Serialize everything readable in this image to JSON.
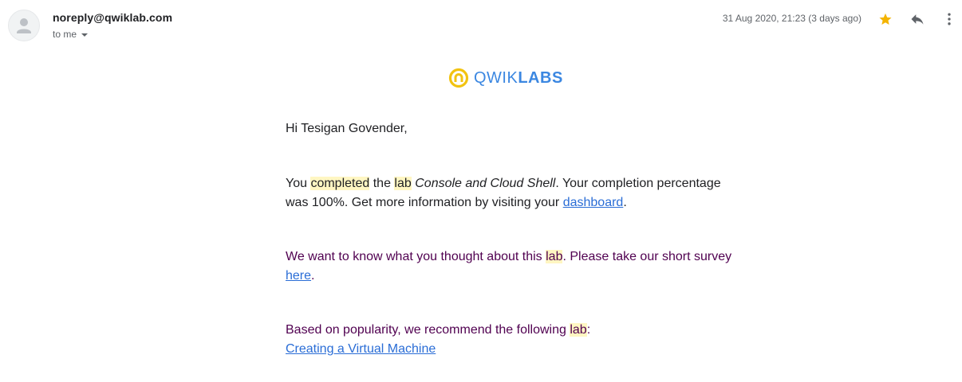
{
  "header": {
    "sender": "noreply@qwiklab.com",
    "recipient": "to me",
    "date": "31 Aug 2020, 21:23 (3 days ago)",
    "icons": {
      "avatar": "default-avatar-icon",
      "star": "star-icon",
      "reply": "reply-icon",
      "more": "more-vert-icon"
    },
    "colors": {
      "star": "#f4b400",
      "icon_grey": "#5f6368"
    }
  },
  "logo": {
    "part1": "QWIK",
    "part2": "LABS",
    "colors": {
      "ring": "#f2c311",
      "text": "#3b87e1"
    }
  },
  "message": {
    "greeting": "Hi Tesigan Govender,",
    "completion": {
      "t1": "You ",
      "hl1": "completed",
      "t2": " the ",
      "hl2": "lab",
      "t3": " ",
      "lab_title": "Console and Cloud Shell",
      "t4": ". Your completion percentage was 100%. Get more information by visiting your ",
      "link": "dashboard",
      "t5": "."
    },
    "survey": {
      "t1": "We want to know what you thought about this ",
      "hl": "lab",
      "t2": ". Please take our short survey ",
      "link": "here",
      "t3": "."
    },
    "recommend": {
      "t1": "Based on popularity, we recommend the following ",
      "hl": "lab",
      "t2": ":",
      "link": "Creating a Virtual Machine"
    },
    "colors": {
      "highlight": "#fff6c2",
      "link": "#2a6dd6",
      "quoted_text": "#500050"
    }
  }
}
